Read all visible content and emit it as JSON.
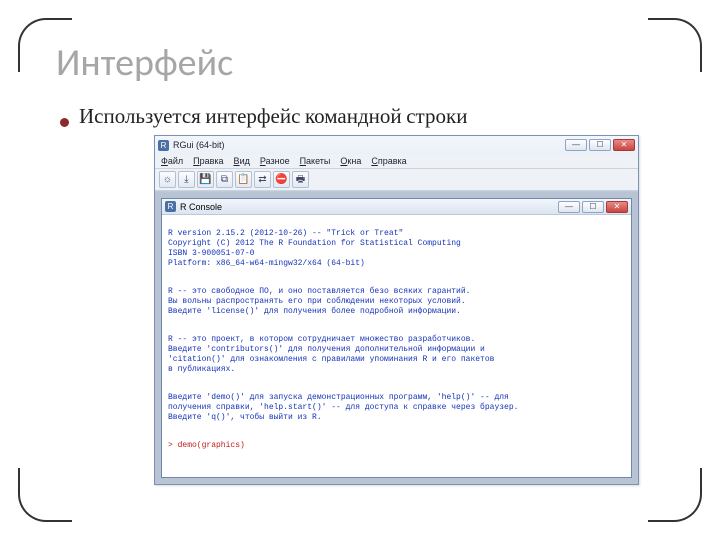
{
  "slide": {
    "title": "Интерфейс",
    "bullet": "Используется интерфейс командной строки"
  },
  "rgui": {
    "window_title": "RGui (64-bit)",
    "menu": [
      "Файл",
      "Правка",
      "Вид",
      "Разное",
      "Пакеты",
      "Окна",
      "Справка"
    ],
    "toolbar_icons": [
      "open-icon",
      "load-icon",
      "save-icon",
      "copy-icon",
      "paste-icon",
      "copy-paste-icon",
      "stop-icon",
      "print-icon"
    ],
    "console": {
      "title": "R Console",
      "text_blocks": [
        "R version 2.15.2 (2012-10-26) -- \"Trick or Treat\"\nCopyright (C) 2012 The R Foundation for Statistical Computing\nISBN 3-900051-07-0\nPlatform: x86_64-w64-mingw32/x64 (64-bit)",
        "R -- это свободное ПО, и оно поставляется безо всяких гарантий.\nВы вольны распространять его при соблюдении некоторых условий.\nВведите 'license()' для получения более подробной информации.",
        "R -- это проект, в котором сотрудничает множество разработчиков.\nВведите 'contributors()' для получения дополнительной информации и\n'citation()' для ознакомления с правилами упоминания R и его пакетов\nв публикациях.",
        "Введите 'demo()' для запуска демонстрационных программ, 'help()' -- для\nполучения справки, 'help.start()' -- для доступа к справке через браузер.\nВведите 'q()', чтобы выйти из R."
      ],
      "prompt": "> demo(graphics)"
    }
  },
  "winbtn": {
    "min": "—",
    "max": "☐",
    "close": "✕"
  }
}
